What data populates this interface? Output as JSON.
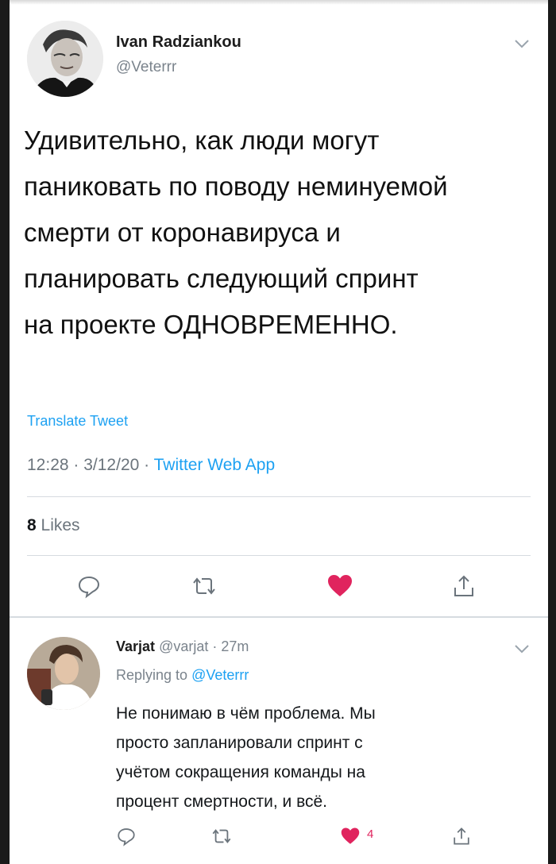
{
  "main_tweet": {
    "author_name": "Ivan Radziankou",
    "author_handle": "@Veterrr",
    "text": "Удивительно, как люди могут\nпаниковать по поводу неминуемой\nсмерти от коронавируса и\nпланировать следующий спринт\nна проекте ОДНОВРЕМЕННО.",
    "translate_label": "Translate Tweet",
    "time": "12:28",
    "date": "3/12/20",
    "source": "Twitter Web App",
    "separator": " · ",
    "likes_count": "8",
    "likes_label": " Likes",
    "liked": true
  },
  "reply_tweet": {
    "author_name": "Varjat",
    "author_handle": "@varjat",
    "separator": " · ",
    "time_ago": "27m",
    "replying_prefix": "Replying to ",
    "replying_to": "@Veterrr",
    "text": "Не понимаю в чём проблема. Мы\nпросто запланировали спринт с\nучётом сокращения команды на\nпроцент смертности, и всё.",
    "like_count": "4",
    "liked": true
  },
  "icons": {
    "reply": "reply-icon",
    "retweet": "retweet-icon",
    "like": "heart-icon",
    "share": "share-icon",
    "menu": "chevron-down-icon"
  },
  "colors": {
    "accent": "#1da1f2",
    "like": "#e0245e",
    "muted_text": "#7a838c"
  }
}
